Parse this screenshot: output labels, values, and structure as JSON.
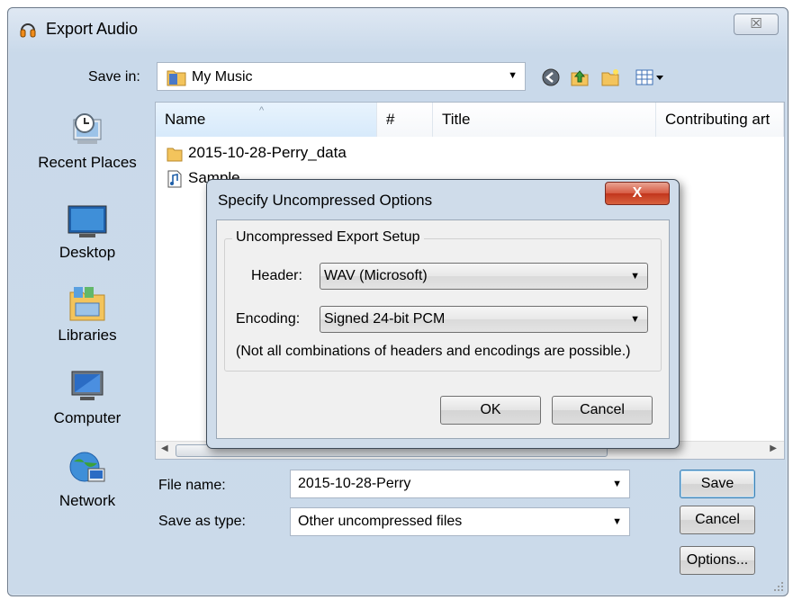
{
  "window": {
    "title": "Export Audio",
    "close_glyph": "☒"
  },
  "toolbar": {
    "save_in_label": "Save in:",
    "save_in_value": "My Music",
    "icons": [
      "back-icon",
      "up-folder-icon",
      "new-folder-icon",
      "views-menu-icon"
    ]
  },
  "places": [
    {
      "label": "Recent Places",
      "icon": "recent-places-icon"
    },
    {
      "label": "Desktop",
      "icon": "desktop-icon"
    },
    {
      "label": "Libraries",
      "icon": "libraries-icon"
    },
    {
      "label": "Computer",
      "icon": "computer-icon"
    },
    {
      "label": "Network",
      "icon": "network-icon"
    }
  ],
  "filelist": {
    "columns": [
      "Name",
      "#",
      "Title",
      "Contributing art"
    ],
    "sort_indicator": "^",
    "rows": [
      {
        "name": "2015-10-28-Perry_data",
        "icon": "folder-icon"
      },
      {
        "name": "Sample",
        "icon": "audio-file-icon"
      }
    ]
  },
  "form": {
    "file_name_label": "File name:",
    "file_name_value": "2015-10-28-Perry",
    "save_type_label": "Save as type:",
    "save_type_value": "Other uncompressed files",
    "save_button": "Save",
    "cancel_button": "Cancel",
    "options_button": "Options..."
  },
  "modal": {
    "title": "Specify Uncompressed Options",
    "close_label": "X",
    "group_label": "Uncompressed Export Setup",
    "header_label": "Header:",
    "header_value": "WAV (Microsoft)",
    "encoding_label": "Encoding:",
    "encoding_value": "Signed 24-bit PCM",
    "note": "(Not all combinations of headers and encodings are possible.)",
    "ok_button": "OK",
    "cancel_button": "Cancel"
  },
  "colors": {
    "window_bg": "#cbdaea",
    "modal_close": "#c2361c",
    "default_button_border": "#3c7fb1"
  }
}
